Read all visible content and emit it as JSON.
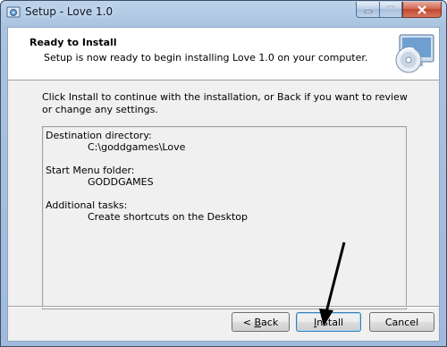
{
  "window": {
    "title": "Setup - Love 1.0"
  },
  "header": {
    "title": "Ready to Install",
    "subtitle": "Setup is now ready to begin installing Love 1.0 on your computer."
  },
  "body": {
    "instruction": "Click Install to continue with the installation, or Back if you want to review or change any settings."
  },
  "summary": [
    {
      "label": "Destination directory:",
      "value": "C:\\goddgames\\Love"
    },
    {
      "label": "Start Menu folder:",
      "value": "GODDGAMES"
    },
    {
      "label": "Additional tasks:",
      "value": "Create shortcuts on the Desktop"
    }
  ],
  "buttons": {
    "back_prefix": "< ",
    "back_accel": "B",
    "back_rest": "ack",
    "install_accel": "I",
    "install_rest": "nstall",
    "cancel": "Cancel"
  },
  "colors": {
    "titlebar": "#a9c3df",
    "close_button": "#c3472e",
    "arrow": "#000000"
  }
}
